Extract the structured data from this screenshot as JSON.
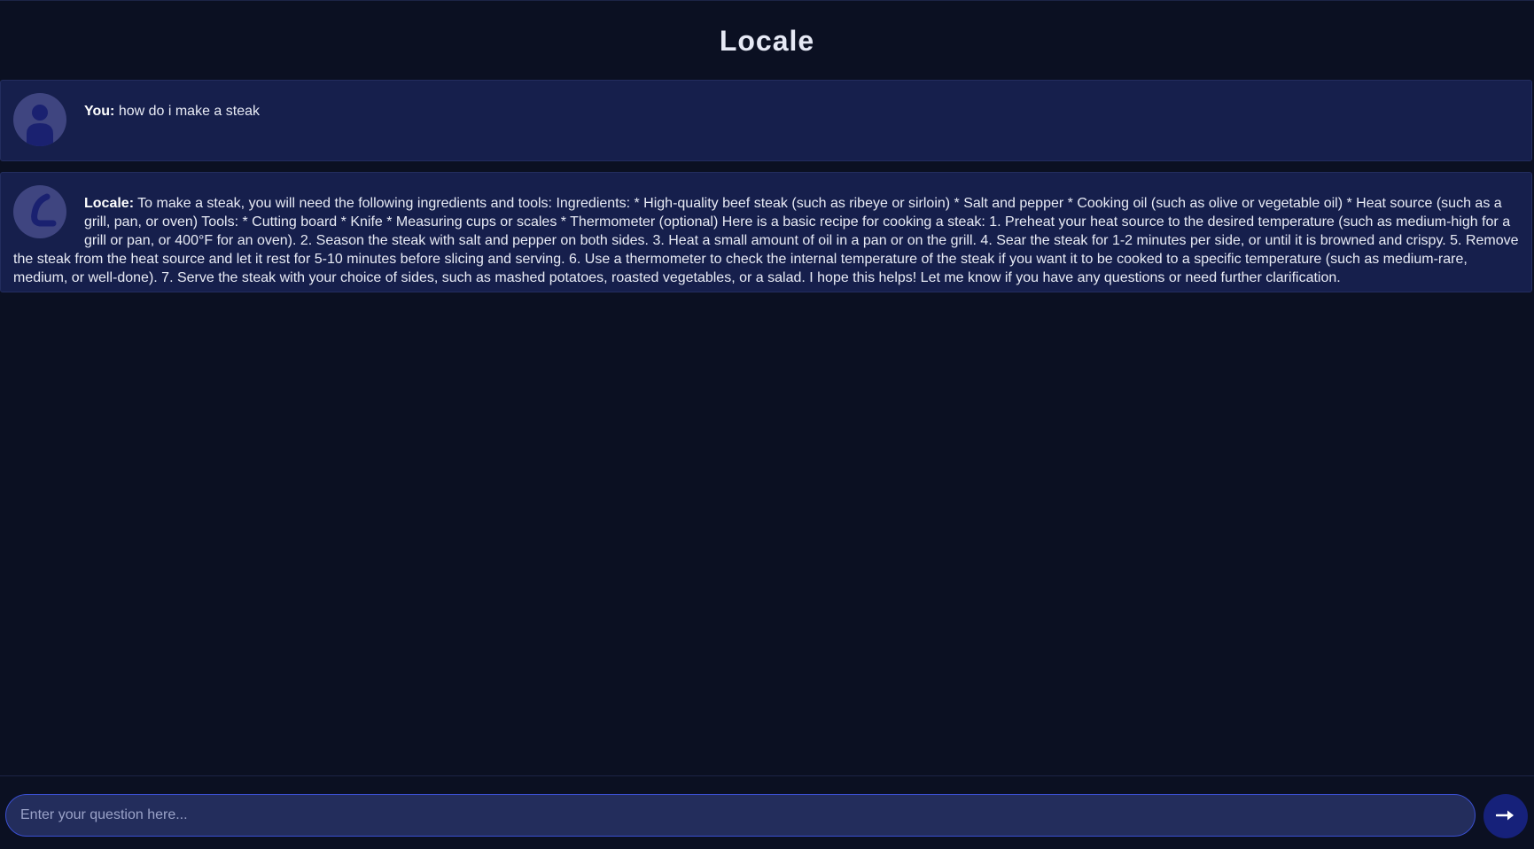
{
  "app": {
    "title": "Locale"
  },
  "messages": [
    {
      "sender": "You:",
      "avatar_icon": "user-silhouette-icon",
      "text": "how do i make a steak"
    },
    {
      "sender": "Locale:",
      "avatar_icon": "locale-logo-icon",
      "text": "To make a steak, you will need the following ingredients and tools: Ingredients: * High-quality beef steak (such as ribeye or sirloin) * Salt and pepper * Cooking oil (such as olive or vegetable oil) * Heat source (such as a grill, pan, or oven) Tools: * Cutting board * Knife * Measuring cups or scales * Thermometer (optional) Here is a basic recipe for cooking a steak: 1. Preheat your heat source to the desired temperature (such as medium-high for a grill or pan, or 400°F for an oven). 2. Season the steak with salt and pepper on both sides. 3. Heat a small amount of oil in a pan or on the grill. 4. Sear the steak for 1-2 minutes per side, or until it is browned and crispy. 5. Remove the steak from the heat source and let it rest for 5-10 minutes before slicing and serving. 6. Use a thermometer to check the internal temperature of the steak if you want it to be cooked to a specific temperature (such as medium-rare, medium, or well-done). 7. Serve the steak with your choice of sides, such as mashed potatoes, roasted vegetables, or a salad. I hope this helps! Let me know if you have any questions or need further clarification."
    }
  ],
  "input": {
    "placeholder": "Enter your question here...",
    "value": ""
  },
  "send_button": {
    "icon": "arrow-right-icon"
  },
  "colors": {
    "background": "#0b1022",
    "message_bg": "#161f4c",
    "avatar_bg": "#3f4580",
    "accent": "#16217a",
    "input_border": "#3a4fd0"
  }
}
